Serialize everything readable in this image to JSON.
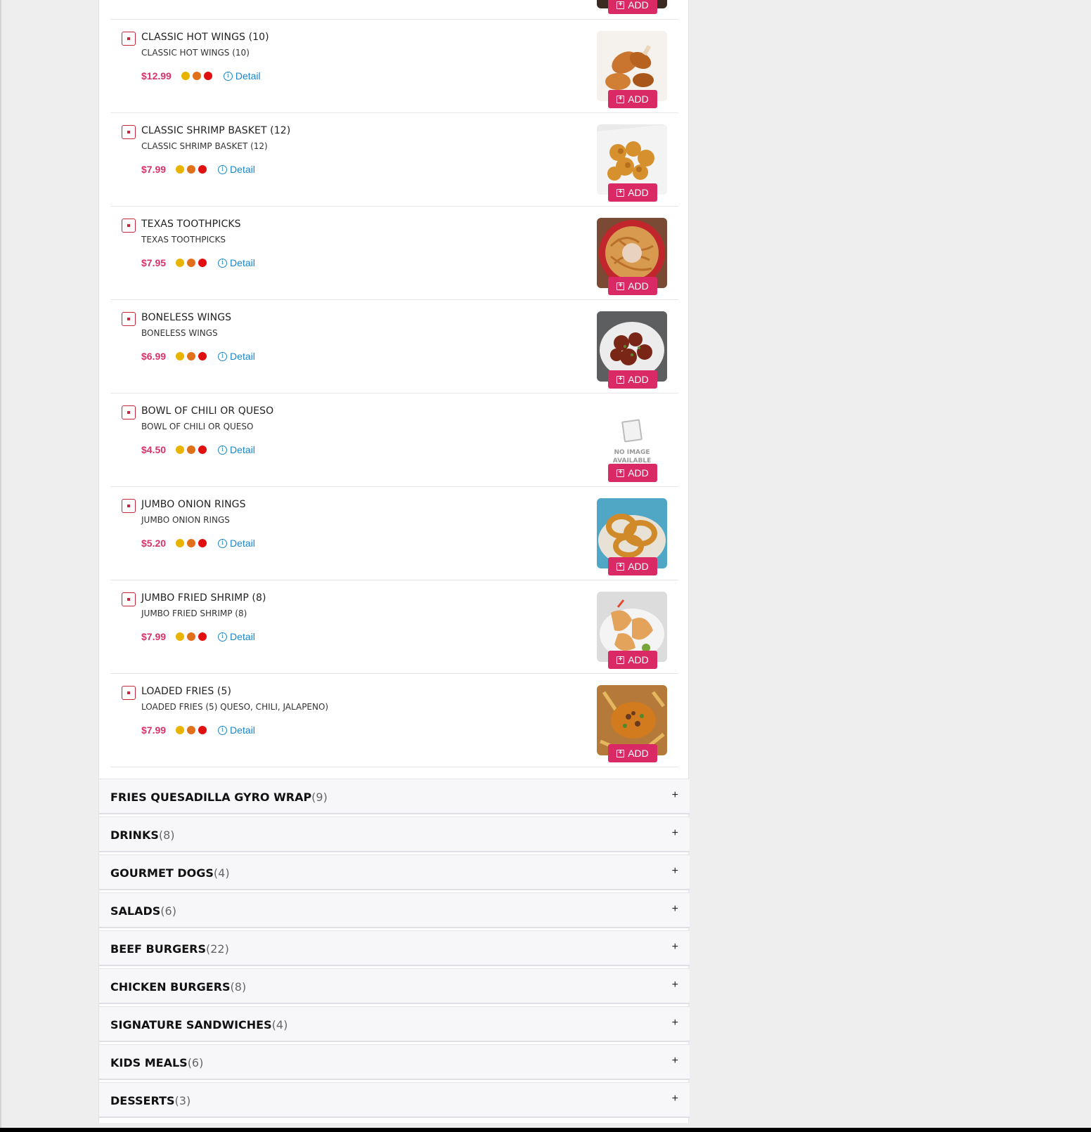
{
  "colors": {
    "accent": "#d92a65",
    "price": "#d6336c",
    "link": "#1a86c8",
    "spice_dots": [
      "#e8b400",
      "#e0701a",
      "#e01010"
    ]
  },
  "add_label": "ADD",
  "detail_label": "Detail",
  "no_image_text": "NO IMAGE AVAILABLE",
  "items": [
    {
      "name": "CLASSIC HOT WINGS (10)",
      "desc": "CLASSIC HOT WINGS (10)",
      "price": "$12.99",
      "image": "wings"
    },
    {
      "name": "CLASSIC SHRIMP BASKET (12)",
      "desc": "CLASSIC SHRIMP BASKET (12)",
      "price": "$7.99",
      "image": "shrimp-basket"
    },
    {
      "name": "TEXAS TOOTHPICKS",
      "desc": "TEXAS TOOTHPICKS",
      "price": "$7.95",
      "image": "toothpicks"
    },
    {
      "name": "BONELESS WINGS",
      "desc": "BONELESS WINGS",
      "price": "$6.99",
      "image": "boneless-wings"
    },
    {
      "name": "BOWL OF CHILI OR QUESO",
      "desc": "BOWL OF CHILI OR QUESO",
      "price": "$4.50",
      "image": "none"
    },
    {
      "name": "JUMBO ONION RINGS",
      "desc": "JUMBO ONION RINGS",
      "price": "$5.20",
      "image": "onion-rings"
    },
    {
      "name": "JUMBO FRIED SHRIMP (8)",
      "desc": "JUMBO FRIED SHRIMP (8)",
      "price": "$7.99",
      "image": "fried-shrimp"
    },
    {
      "name": "LOADED FRIES (5)",
      "desc": "LOADED FRIES (5) QUESO, CHILI, JALAPENO)",
      "price": "$7.99",
      "image": "loaded-fries"
    }
  ],
  "categories": [
    {
      "name": "FRIES QUESADILLA GYRO WRAP",
      "count": "(9)"
    },
    {
      "name": "DRINKS",
      "count": "(8)"
    },
    {
      "name": "GOURMET DOGS",
      "count": "(4)"
    },
    {
      "name": "SALADS",
      "count": "(6)"
    },
    {
      "name": "BEEF BURGERS",
      "count": "(22)"
    },
    {
      "name": "CHICKEN BURGERS",
      "count": "(8)"
    },
    {
      "name": "SIGNATURE SANDWICHES",
      "count": "(4)"
    },
    {
      "name": "KIDS MEALS",
      "count": "(6)"
    },
    {
      "name": "DESSERTS",
      "count": "(3)"
    }
  ],
  "expand_symbol": "+"
}
